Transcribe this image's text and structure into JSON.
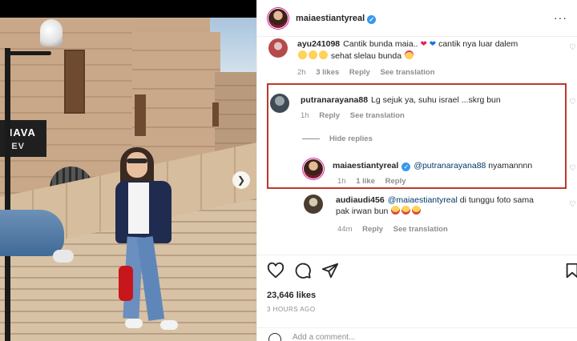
{
  "photo": {
    "sign_text": "HAVA",
    "sign_sub": "SEV"
  },
  "header": {
    "username": "maiaestiantyreal",
    "more": "···"
  },
  "comments": [
    {
      "username": "ayu241098",
      "text_a": "Cantik bunda maia..",
      "text_b": "cantik nya luar dalem",
      "text_c": "sehat slelau bunda",
      "time": "2h",
      "likes": "3 likes",
      "reply": "Reply",
      "translate": "See translation"
    },
    {
      "username": "putranarayana88",
      "text": "Lg sejuk ya, suhu israel ...skrg bun",
      "time": "1h",
      "reply": "Reply",
      "translate": "See translation",
      "hide_replies": "Hide replies"
    },
    {
      "username": "maiaestiantyreal",
      "mention": "@putranarayana88",
      "text": "nyamannnn",
      "time": "1h",
      "likes": "1 like",
      "reply": "Reply"
    },
    {
      "username": "audiaudi456",
      "mention": "@maiaestiantyreal",
      "text_a": "di tunggu foto sama",
      "text_b": "pak irwan bun",
      "time": "44m",
      "reply": "Reply",
      "translate": "See translation"
    }
  ],
  "footer": {
    "likes": "23,646 likes",
    "time_ago": "3 HOURS AGO",
    "add_comment_placeholder": "Add a comment..."
  },
  "colors": {
    "highlight_border": "#c0372a",
    "verified": "#3897f0",
    "link": "#00376b"
  }
}
